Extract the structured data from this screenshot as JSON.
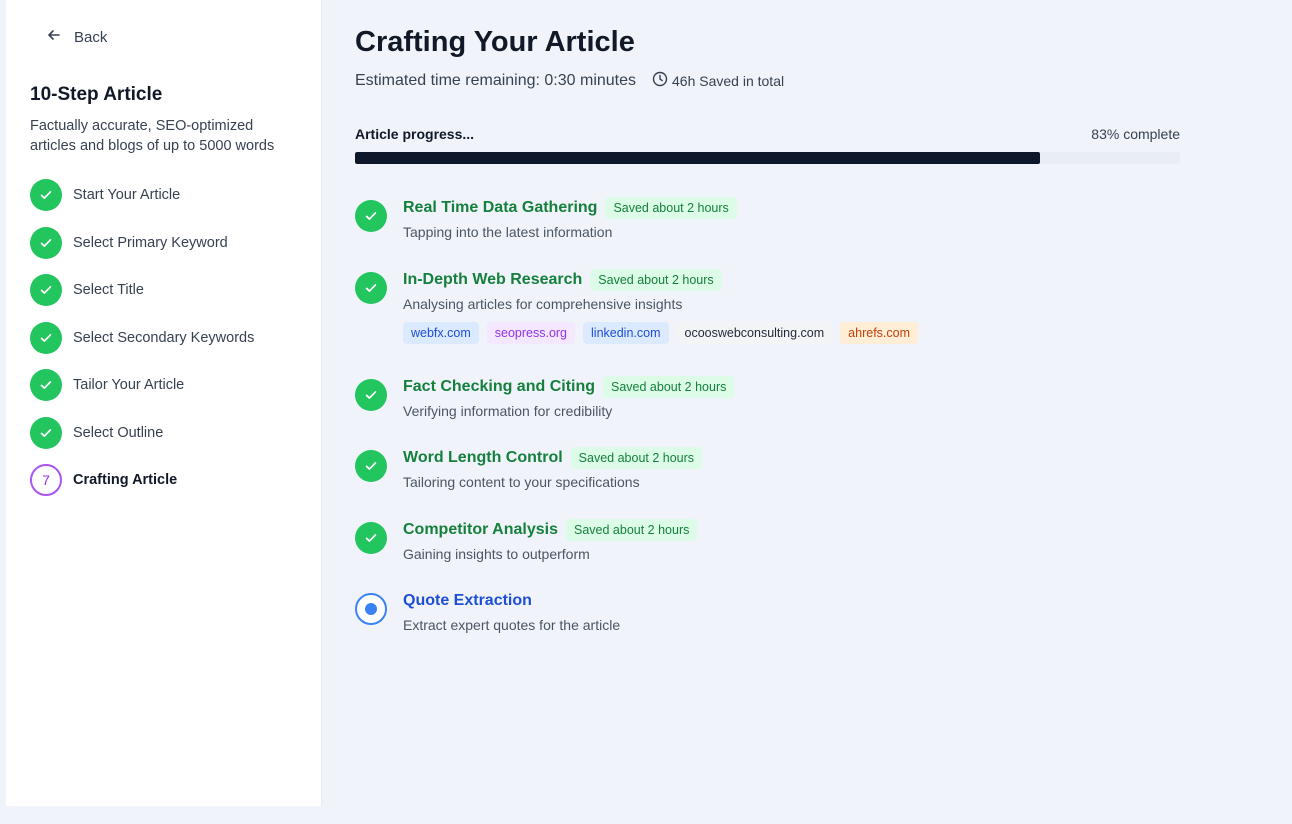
{
  "sidebar": {
    "back_label": "Back",
    "title": "10-Step Article",
    "description": "Factually accurate, SEO-optimized articles and blogs of up to 5000 words",
    "steps": [
      {
        "label": "Start Your Article",
        "status": "done"
      },
      {
        "label": "Select Primary Keyword",
        "status": "done"
      },
      {
        "label": "Select Title",
        "status": "done"
      },
      {
        "label": "Select Secondary Keywords",
        "status": "done"
      },
      {
        "label": "Tailor Your Article",
        "status": "done"
      },
      {
        "label": "Select Outline",
        "status": "done"
      },
      {
        "label": "Crafting Article",
        "status": "current",
        "number": "7"
      }
    ]
  },
  "main": {
    "title": "Crafting Your Article",
    "eta": "Estimated time remaining: 0:30 minutes",
    "saved_total": "46h Saved in total",
    "progress": {
      "label": "Article progress...",
      "percent_text": "83% complete",
      "value": 83
    },
    "tasks": [
      {
        "name": "Real Time Data Gathering",
        "badge": "Saved about 2 hours",
        "desc": "Tapping into the latest information",
        "status": "done"
      },
      {
        "name": "In-Depth Web Research",
        "badge": "Saved about 2 hours",
        "desc": "Analysing articles for comprehensive insights",
        "status": "done",
        "sources": [
          {
            "label": "webfx.com",
            "bg": "#dbeafe",
            "fg": "#1d4ed8"
          },
          {
            "label": "seopress.org",
            "bg": "#f3e8ff",
            "fg": "#9333ea"
          },
          {
            "label": "linkedin.com",
            "bg": "#dbeafe",
            "fg": "#1d4ed8"
          },
          {
            "label": "ocooswebconsulting.com",
            "bg": "#f3f4f6",
            "fg": "#1f2937"
          },
          {
            "label": "ahrefs.com",
            "bg": "#ffedd5",
            "fg": "#c2410c"
          }
        ]
      },
      {
        "name": "Fact Checking and Citing",
        "badge": "Saved about 2 hours",
        "desc": "Verifying information for credibility",
        "status": "done"
      },
      {
        "name": "Word Length Control",
        "badge": "Saved about 2 hours",
        "desc": "Tailoring content to your specifications",
        "status": "done"
      },
      {
        "name": "Competitor Analysis",
        "badge": "Saved about 2 hours",
        "desc": "Gaining insights to outperform",
        "status": "done"
      },
      {
        "name": "Quote Extraction",
        "badge": "",
        "desc": "Extract expert quotes for the article",
        "status": "active"
      }
    ]
  },
  "colors": {
    "success": "#22c55e",
    "success_text": "#15803d",
    "active": "#3b82f6",
    "current_step": "#a855f7",
    "progress_fill": "#0f172a"
  }
}
